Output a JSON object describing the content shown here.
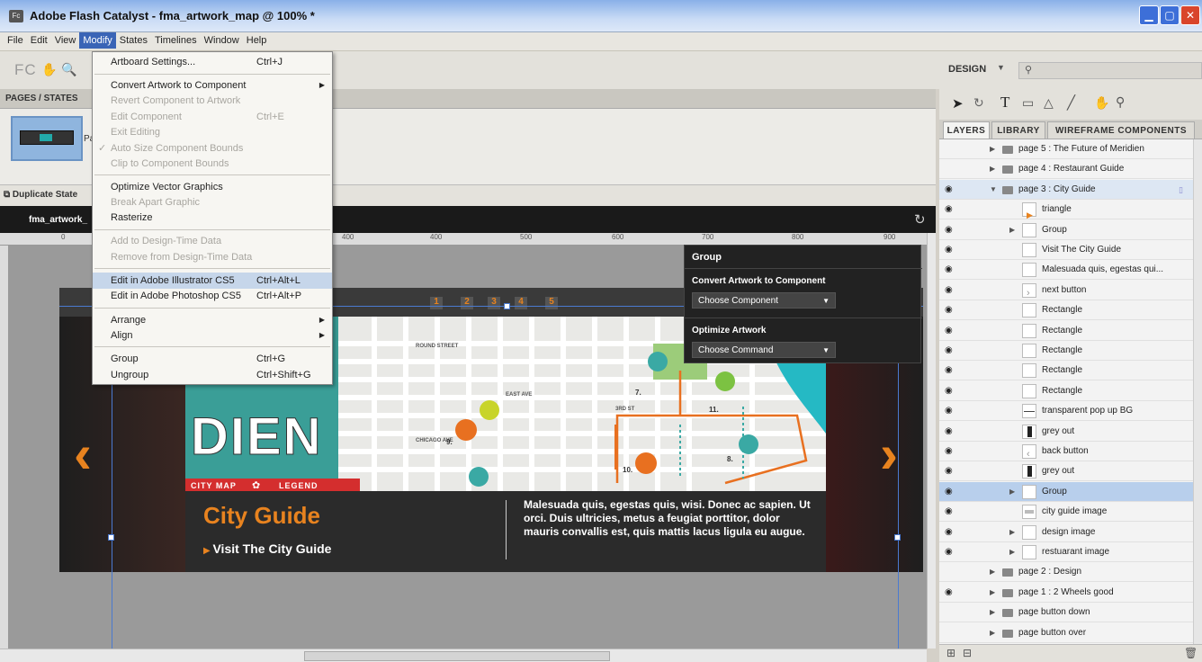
{
  "window": {
    "title": "Adobe Flash Catalyst - fma_artwork_map @ 100% *",
    "app_icon": "Fc"
  },
  "menubar": [
    "File",
    "Edit",
    "View",
    "Modify",
    "States",
    "Timelines",
    "Window",
    "Help"
  ],
  "toolbar": {
    "logo": "FC",
    "workspace": "DESIGN",
    "search_placeholder": ""
  },
  "pages_panel": {
    "header": "PAGES / STATES",
    "page_label": "Pa",
    "duplicate_state": "Duplicate State"
  },
  "document": {
    "tab_label": "fma_artwork_"
  },
  "ruler": {
    "ticks": [
      "0",
      "400",
      "400",
      "500",
      "600",
      "700",
      "800",
      "900"
    ]
  },
  "modify_menu": {
    "items": [
      {
        "label": "Artboard Settings...",
        "shortcut": "Ctrl+J",
        "disabled": false
      },
      {
        "label": "Convert Artwork to Component",
        "shortcut": "",
        "disabled": false,
        "submenu": true
      },
      {
        "label": "Revert Component to Artwork",
        "shortcut": "",
        "disabled": true
      },
      {
        "label": "Edit Component",
        "shortcut": "Ctrl+E",
        "disabled": true
      },
      {
        "label": "Exit Editing",
        "shortcut": "",
        "disabled": true
      },
      {
        "label": "Auto Size Component Bounds",
        "shortcut": "",
        "disabled": true,
        "checked": true
      },
      {
        "label": "Clip to Component Bounds",
        "shortcut": "",
        "disabled": true
      },
      {
        "label": "Optimize Vector Graphics",
        "shortcut": "",
        "disabled": false
      },
      {
        "label": "Break Apart Graphic",
        "shortcut": "",
        "disabled": true
      },
      {
        "label": "Rasterize",
        "shortcut": "",
        "disabled": false
      },
      {
        "label": "Add to Design-Time Data",
        "shortcut": "",
        "disabled": true
      },
      {
        "label": "Remove from Design-Time Data",
        "shortcut": "",
        "disabled": true
      },
      {
        "label": "Edit in Adobe Illustrator CS5",
        "shortcut": "Ctrl+Alt+L",
        "disabled": false,
        "highlighted": true
      },
      {
        "label": "Edit in Adobe Photoshop CS5",
        "shortcut": "Ctrl+Alt+P",
        "disabled": false
      },
      {
        "label": "Arrange",
        "shortcut": "",
        "disabled": false,
        "submenu": true
      },
      {
        "label": "Align",
        "shortcut": "",
        "disabled": false,
        "submenu": true
      },
      {
        "label": "Group",
        "shortcut": "Ctrl+G",
        "disabled": false
      },
      {
        "label": "Ungroup",
        "shortcut": "Ctrl+Shift+G",
        "disabled": false
      }
    ]
  },
  "group_panel": {
    "title": "Group",
    "convert_heading": "Convert Artwork to Component",
    "convert_select": "Choose Component",
    "optimize_heading": "Optimize Artwork",
    "optimize_select": "Choose Command"
  },
  "artwork": {
    "page_numbers": [
      "1",
      "2",
      "3",
      "4",
      "5"
    ],
    "logo_text": "DIEN",
    "ribbon_left": "CITY MAP",
    "ribbon_right": "LEGEND",
    "street_labels": [
      "EAST AVE",
      "3RD ST",
      "CHICAGO AVE",
      "ROUND STREET"
    ],
    "marker_numbers": [
      "7.",
      "11.",
      "9.",
      "10.",
      "8."
    ],
    "heading": "City Guide",
    "link": "Visit The City Guide",
    "body": "Malesuada quis, egestas quis, wisi. Donec ac sapien. Ut orci. Duis ultricies, metus a feugiat porttitor, dolor mauris convallis est, quis mattis lacus ligula eu augue."
  },
  "right_panel": {
    "tabs": [
      "LAYERS",
      "LIBRARY",
      "WIREFRAME COMPONENTS"
    ],
    "layers": [
      {
        "label": "page 5 : The Future of Meridien",
        "type": "folder",
        "indent": 0,
        "eye": false
      },
      {
        "label": "page 4 : Restaurant Guide",
        "type": "folder",
        "indent": 0,
        "eye": false
      },
      {
        "label": "page 3 : City Guide",
        "type": "folder",
        "indent": 0,
        "eye": true,
        "expanded": true,
        "highlight": true
      },
      {
        "label": "triangle",
        "type": "item",
        "indent": 1,
        "eye": true,
        "thumb": "orange-triangle"
      },
      {
        "label": "Group",
        "type": "group",
        "indent": 1,
        "eye": true,
        "collapsed": true
      },
      {
        "label": "Visit The City Guide",
        "type": "item",
        "indent": 1,
        "eye": true
      },
      {
        "label": "Malesuada quis, egestas qui...",
        "type": "item",
        "indent": 1,
        "eye": true
      },
      {
        "label": "next button",
        "type": "item",
        "indent": 1,
        "eye": true,
        "thumb": "right-chevron"
      },
      {
        "label": "Rectangle",
        "type": "item",
        "indent": 1,
        "eye": true
      },
      {
        "label": "Rectangle",
        "type": "item",
        "indent": 1,
        "eye": true
      },
      {
        "label": "Rectangle",
        "type": "item",
        "indent": 1,
        "eye": true
      },
      {
        "label": "Rectangle",
        "type": "item",
        "indent": 1,
        "eye": true
      },
      {
        "label": "Rectangle",
        "type": "item",
        "indent": 1,
        "eye": true
      },
      {
        "label": "transparent pop up BG",
        "type": "item",
        "indent": 1,
        "eye": true,
        "thumb": "line"
      },
      {
        "label": "grey out",
        "type": "item",
        "indent": 1,
        "eye": true,
        "thumb": "dark"
      },
      {
        "label": "back button",
        "type": "item",
        "indent": 1,
        "eye": true,
        "thumb": "left-chevron"
      },
      {
        "label": "grey out",
        "type": "item",
        "indent": 1,
        "eye": true,
        "thumb": "dark"
      },
      {
        "label": "Group",
        "type": "group",
        "indent": 1,
        "eye": true,
        "collapsed": true,
        "selected": true
      },
      {
        "label": "city guide image",
        "type": "item",
        "indent": 1,
        "eye": true,
        "thumb": "image"
      },
      {
        "label": "design image",
        "type": "group",
        "indent": 1,
        "eye": true,
        "collapsed": true
      },
      {
        "label": "restuarant image",
        "type": "group",
        "indent": 1,
        "eye": true,
        "collapsed": true
      },
      {
        "label": "page 2 : Design",
        "type": "folder",
        "indent": 0,
        "eye": false
      },
      {
        "label": "page 1 : 2 Wheels good",
        "type": "folder",
        "indent": 0,
        "eye": true
      },
      {
        "label": "page button down",
        "type": "folder",
        "indent": 0,
        "eye": false
      },
      {
        "label": "page button over",
        "type": "folder",
        "indent": 0,
        "eye": false
      }
    ]
  },
  "colors": {
    "accent": "#e8831f",
    "teal": "#3aa9a4",
    "menu_highlight": "#c6d6ea",
    "layer_selected": "#b8cfec",
    "red_ribbon": "#d42e2e"
  }
}
